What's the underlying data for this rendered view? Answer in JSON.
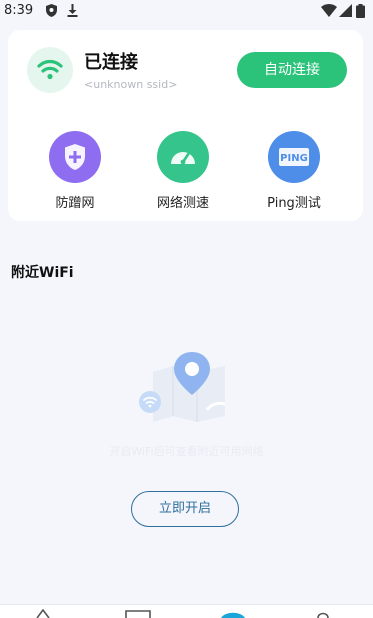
{
  "status_bar": {
    "time": "8:39",
    "icons": [
      "shield-icon",
      "download-icon",
      "wifi-icon",
      "signal-icon",
      "battery-icon"
    ]
  },
  "connection": {
    "status": "已连接",
    "ssid": "<unknown ssid>",
    "auto_connect_label": "自动连接",
    "accent": "#2bc37a"
  },
  "tools": [
    {
      "label": "防蹭网",
      "icon": "shield-plus-icon",
      "color": "#8f6df0"
    },
    {
      "label": "网络测速",
      "icon": "speedometer-icon",
      "color": "#35c58c"
    },
    {
      "label": "Ping测试",
      "icon": "ping-icon",
      "color": "#4e8ee8"
    }
  ],
  "nearby": {
    "title": "附近WiFi",
    "hint": "开启WiFi后可查看附近可用网络",
    "open_button": "立即开启"
  },
  "tabbar": {
    "icons": [
      "home-icon",
      "tools-icon",
      "wifi-tab-icon",
      "profile-icon"
    ]
  }
}
